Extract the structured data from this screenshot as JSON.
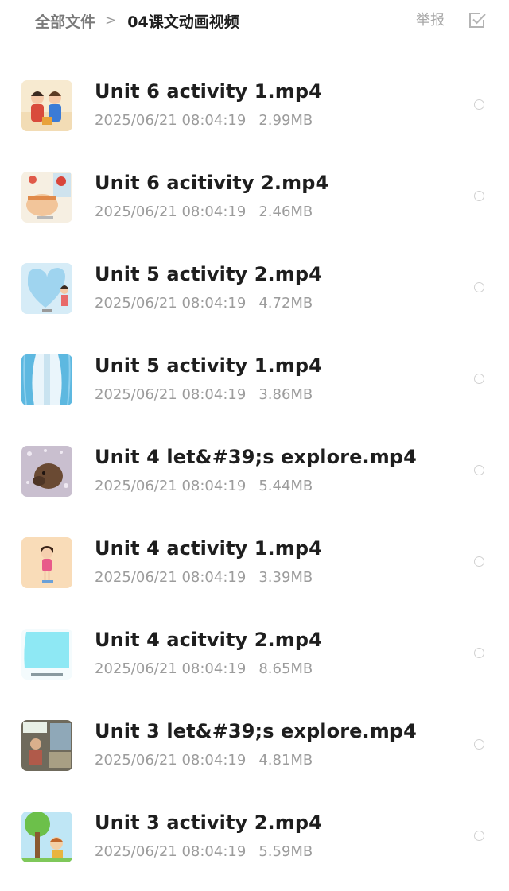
{
  "header": {
    "breadcrumb_root": "全部文件",
    "breadcrumb_separator": ">",
    "breadcrumb_current": "04课文动画视频",
    "report_label": "举报",
    "select_icon": "checkbox-select-icon"
  },
  "files": [
    {
      "name": "Unit 6 activity 1.mp4",
      "date": "2025/06/21 08:04:19",
      "size": "2.99MB",
      "thumb_icon": "video-thumbnail-two-children"
    },
    {
      "name": "Unit 6 acitivity 2.mp4",
      "date": "2025/06/21 08:04:19",
      "size": "2.46MB",
      "thumb_icon": "video-thumbnail-festival-scene"
    },
    {
      "name": "Unit 5 activity 2.mp4",
      "date": "2025/06/21 08:04:19",
      "size": "4.72MB",
      "thumb_icon": "video-thumbnail-heart-frame"
    },
    {
      "name": "Unit 5 activity 1.mp4",
      "date": "2025/06/21 08:04:19",
      "size": "3.86MB",
      "thumb_icon": "video-thumbnail-curtains"
    },
    {
      "name": "Unit 4 let&#39;s explore.mp4",
      "date": "2025/06/21 08:04:19",
      "size": "5.44MB",
      "thumb_icon": "video-thumbnail-animal-photo"
    },
    {
      "name": "Unit 4 activity 1.mp4",
      "date": "2025/06/21 08:04:19",
      "size": "3.39MB",
      "thumb_icon": "video-thumbnail-girl"
    },
    {
      "name": "Unit 4 acitvity 2.mp4",
      "date": "2025/06/21 08:04:19",
      "size": "8.65MB",
      "thumb_icon": "video-thumbnail-cyan-card"
    },
    {
      "name": "Unit 3 let&#39;s explore.mp4",
      "date": "2025/06/21 08:04:19",
      "size": "4.81MB",
      "thumb_icon": "video-thumbnail-photo-collage"
    },
    {
      "name": "Unit 3 activity 2.mp4",
      "date": "2025/06/21 08:04:19",
      "size": "5.59MB",
      "thumb_icon": "video-thumbnail-tree-scene"
    }
  ],
  "colors": {
    "title_text": "#1e1e1e",
    "meta_text": "#9c9c9c",
    "radio_border": "#d0d0d0",
    "header_muted": "#a8a8a8"
  }
}
